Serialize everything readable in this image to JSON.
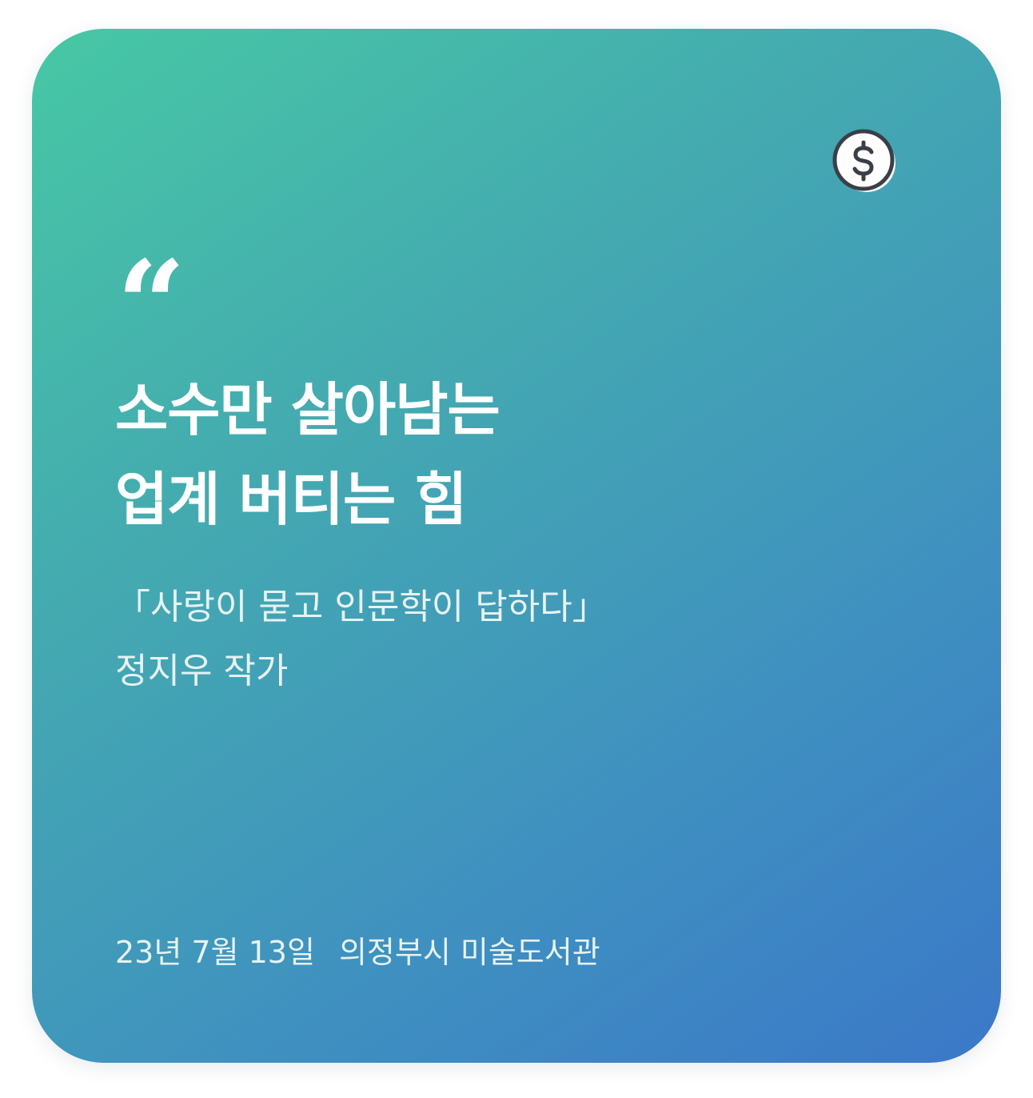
{
  "card": {
    "icon": "dollar-coin-icon",
    "quote_mark": "“",
    "headline": {
      "line1": "소수만 살아남는",
      "line2": "업계 버티는 힘"
    },
    "book_title": "「사랑이 묻고 인문학이 답하다」",
    "author": "정지우 작가",
    "date": "23년 7월 13일",
    "venue": "의정부시 미술도서관"
  },
  "colors": {
    "gradient_start": "#47c8a4",
    "gradient_end": "#3b78c8",
    "text_primary": "#ffffff",
    "text_secondary": "#e6f3f3"
  }
}
